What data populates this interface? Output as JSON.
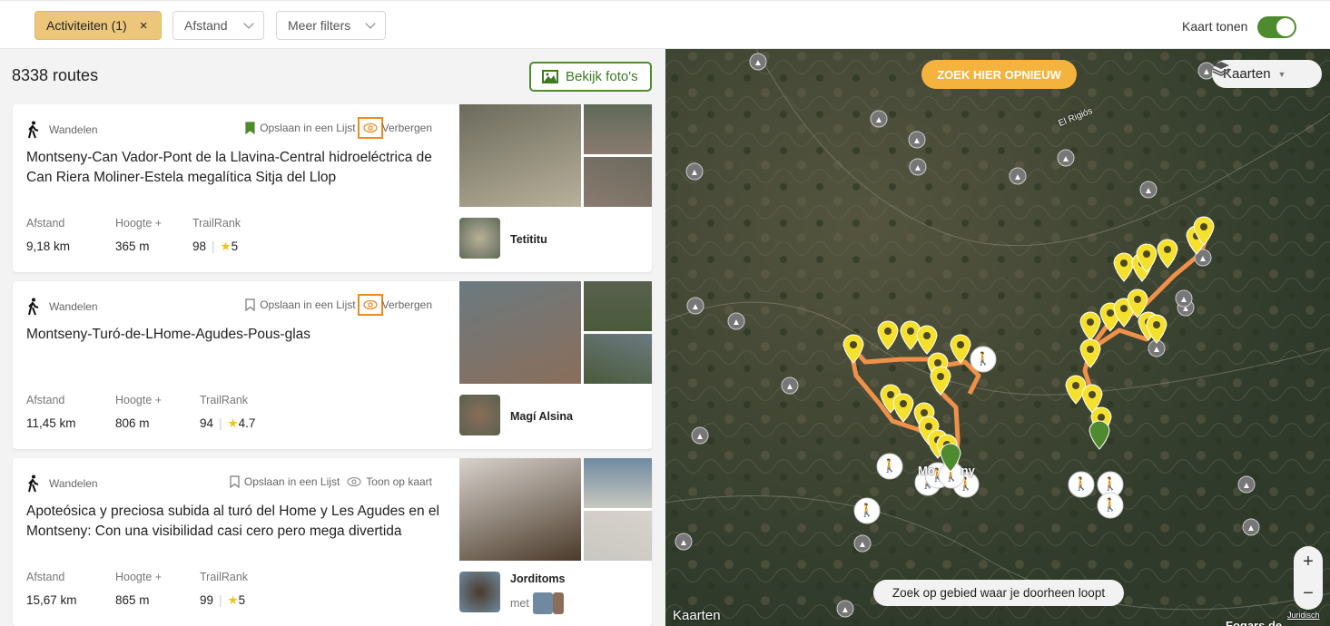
{
  "filters": {
    "activities": "Activiteiten (1)",
    "activities_clear": "×",
    "distance": "Afstand",
    "more": "Meer filters"
  },
  "map_toggle": {
    "label": "Kaart tonen",
    "on": true
  },
  "list": {
    "count": "8338 routes",
    "photos_button": "Bekijk foto's"
  },
  "stat_labels": {
    "distance": "Afstand",
    "elevation": "Hoogte +",
    "rank": "TrailRank"
  },
  "routes": [
    {
      "activity": "Wandelen",
      "save": "Opslaan in een Lijst",
      "saved": true,
      "hide": "Verbergen",
      "title": "Montseny-Can Vador-Pont de la Llavina-Central hidroeléctrica de Can Riera Moliner-Estela megalítica Sitja del Llop",
      "distance": "9,18 km",
      "elevation": "365 m",
      "rank": "98",
      "rating": "5",
      "author": "Tetititu"
    },
    {
      "activity": "Wandelen",
      "save": "Opslaan in een Lijst",
      "saved": false,
      "hide": "Verbergen",
      "title": "Montseny-Turó-de-LHome-Agudes-Pous-glas",
      "distance": "11,45 km",
      "elevation": "806 m",
      "rank": "94",
      "rating": "4.7",
      "author": "Magí Alsina"
    },
    {
      "activity": "Wandelen",
      "save": "Opslaan in een Lijst",
      "saved": false,
      "hide": "Toon op kaart",
      "title": "Apoteósica y preciosa subida al turó del Home y Les Agudes en el Montseny: Con una visibilidad casi cero pero mega divertida",
      "distance": "15,67 km",
      "elevation": "865 m",
      "rank": "99",
      "rating": "5",
      "author": "Jorditoms",
      "with": "met"
    }
  ],
  "map": {
    "research": "ZOEK HIER OPNIEUW",
    "layers": "Kaarten",
    "zoom_in": "+",
    "zoom_out": "−",
    "search_area": "Zoek op gebied waar je doorheen loopt",
    "place1": "El Rigiós",
    "place2": "Mo        ny",
    "place3": "Fogars de",
    "attribution": "Kaarten",
    "legal": "Juridisch"
  },
  "colors": {
    "accent": "#4e8a2e",
    "route": "#f0914a",
    "marker": "#f5e02c",
    "research": "#f4b33d"
  }
}
